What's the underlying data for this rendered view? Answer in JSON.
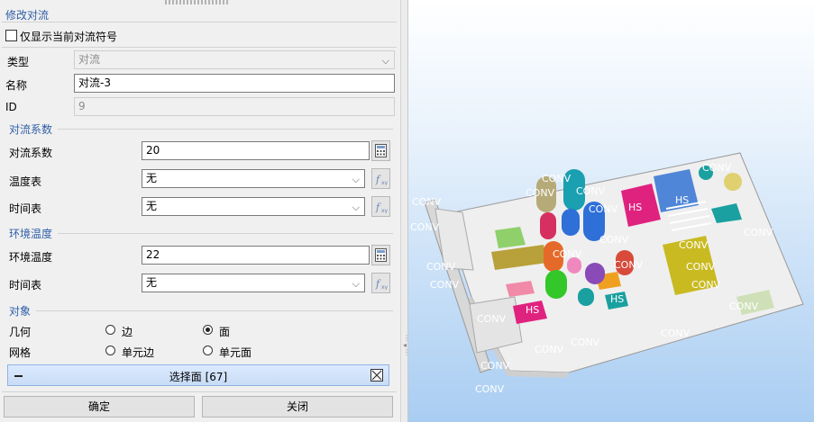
{
  "panel": {
    "title": "修改对流",
    "show_current_only_label": "仅显示当前对流符号",
    "type_label": "类型",
    "type_value": "对流",
    "name_label": "名称",
    "name_value": "对流-3",
    "id_label": "ID",
    "id_value": "9",
    "coef_group": "对流系数",
    "coef_label": "对流系数",
    "coef_value": "20",
    "temp_table_label": "温度表",
    "temp_table_value": "无",
    "time_table_label": "时间表",
    "time_table_value": "无",
    "ambient_group": "环境温度",
    "ambient_label": "环境温度",
    "ambient_value": "22",
    "ambient_time_label": "时间表",
    "ambient_time_value": "无",
    "object_group": "对象",
    "geometry_label": "几何",
    "geom_edge": "边",
    "geom_face": "面",
    "mesh_label": "网格",
    "mesh_edge": "单元边",
    "mesh_face": "单元面",
    "select_bar_label": "选择面 [67]",
    "ok_button": "确定",
    "close_button": "关闭"
  },
  "viewport": {
    "symbol_labels": [
      "CONV",
      "HS"
    ]
  },
  "colors": {
    "accent": "#2f5fa8",
    "select_bar": "#cfe0f7",
    "viewport_bottom": "#a9cdf2"
  }
}
